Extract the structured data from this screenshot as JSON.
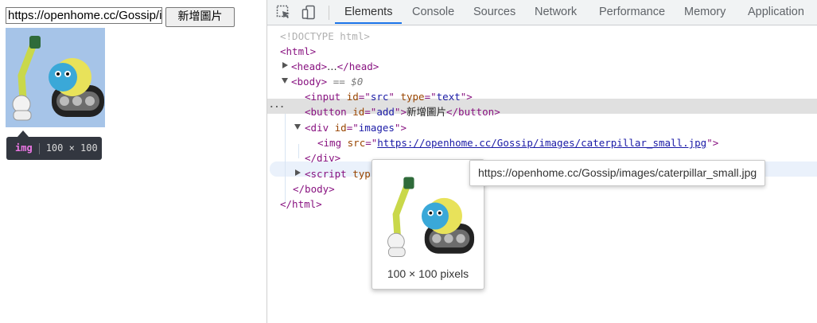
{
  "page": {
    "src_input_value": "https://openhome.cc/Gossip/images/caterpillar_small.jpg",
    "add_button_label": "新增圖片",
    "inspect_tooltip": {
      "tag": "img",
      "size": "100 × 100"
    }
  },
  "devtools": {
    "tabs": [
      "Elements",
      "Console",
      "Sources",
      "Network",
      "Performance",
      "Memory",
      "Application"
    ],
    "active_tab": "Elements",
    "icons": [
      "inspect-element-icon",
      "device-toggle-icon"
    ],
    "tree": {
      "doctype": "<!DOCTYPE html>",
      "html_open": "<html>",
      "head": {
        "open": "<head>",
        "ellipsis": "…",
        "close": "</head>"
      },
      "body_open": "<body>",
      "body_selected_suffix": "== $0",
      "input": {
        "tag": "input",
        "attr1": "id",
        "val1": "src",
        "attr2": "type",
        "val2": "text"
      },
      "button": {
        "tag": "button",
        "attr": "id",
        "val": "add",
        "text": "新增圖片",
        "close": "</button>"
      },
      "div": {
        "tag": "div",
        "attr": "id",
        "val": "images"
      },
      "img": {
        "tag": "img",
        "attr": "src",
        "val": "https://openhome.cc/Gossip/images/caterpillar_small.jpg"
      },
      "div_close": "</div>",
      "script": {
        "tag": "script",
        "partial_attr": "typ"
      },
      "body_close": "</body>",
      "html_close": "</html>"
    },
    "image_preview": {
      "caption": "100 × 100 pixels"
    },
    "url_tooltip": "https://openhome.cc/Gossip/images/caterpillar_small.jpg"
  },
  "colors": {
    "tag": "#881280",
    "attr": "#994500",
    "value": "#1a1aa6",
    "accent": "#1a73e8",
    "image_bg": "#a6c4e8"
  }
}
